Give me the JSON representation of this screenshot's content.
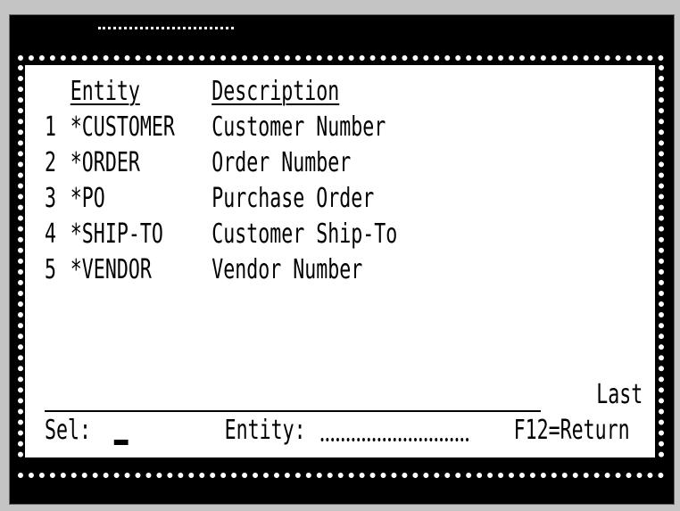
{
  "screen": {
    "columns": {
      "entity_header": "Entity",
      "description_header": "Description"
    },
    "rows": [
      {
        "num": "1",
        "entity": "*CUSTOMER",
        "description": "Customer Number"
      },
      {
        "num": "2",
        "entity": "*ORDER",
        "description": "Order Number"
      },
      {
        "num": "3",
        "entity": "*PO",
        "description": "Purchase Order"
      },
      {
        "num": "4",
        "entity": "*SHIP-TO",
        "description": "Customer Ship-To"
      },
      {
        "num": "5",
        "entity": "*VENDOR",
        "description": "Vendor Number"
      }
    ],
    "status": "Last",
    "footer": {
      "sel_label": "Sel:",
      "entity_label": "Entity:",
      "return_key": "F12=Return"
    }
  }
}
